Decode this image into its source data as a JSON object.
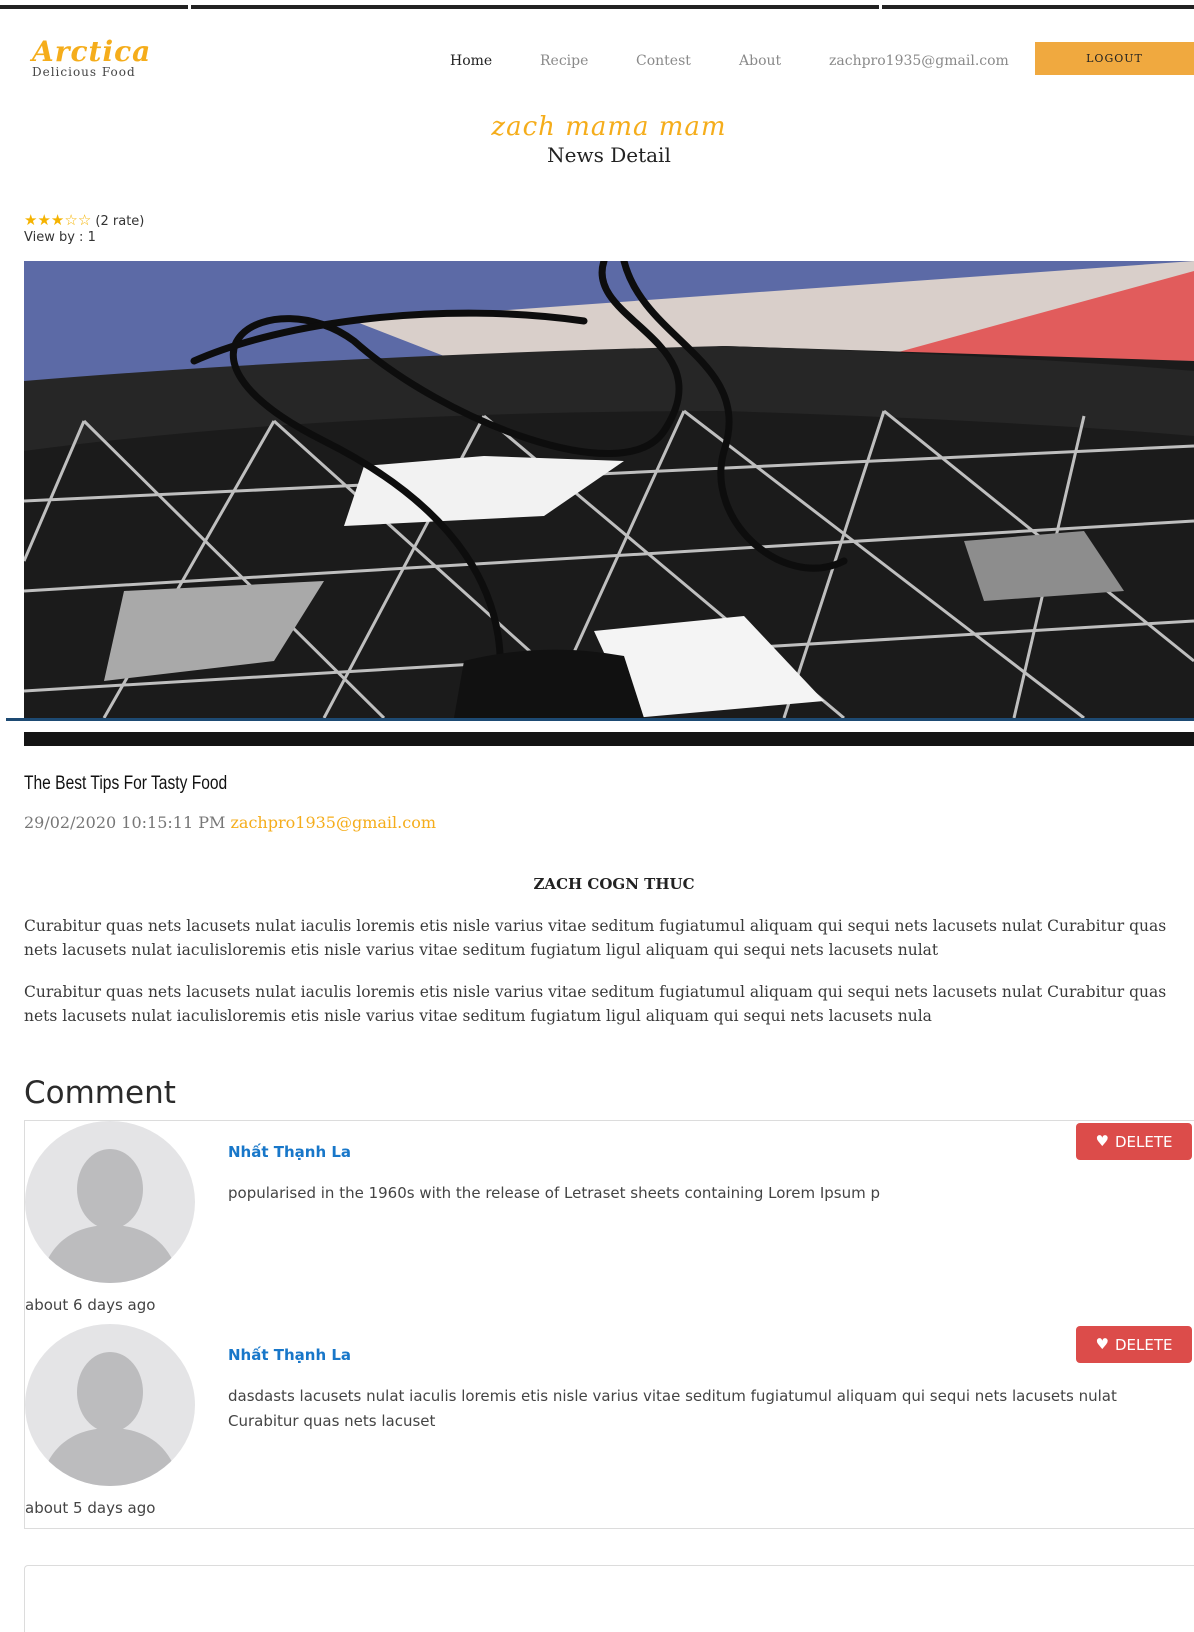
{
  "brand": {
    "name": "Arctica",
    "tagline": "Delicious Food"
  },
  "nav": {
    "items": [
      {
        "label": "Home"
      },
      {
        "label": "Recipe"
      },
      {
        "label": "Contest"
      },
      {
        "label": "About"
      },
      {
        "label": "zachpro1935@gmail.com"
      }
    ],
    "active": "Home",
    "logout_label": "LOGOUT"
  },
  "hero": {
    "script_title": "zach mama mam",
    "subtitle": "News Detail"
  },
  "rating": {
    "stars_filled": 3,
    "stars_total": 5,
    "label": "(2 rate)",
    "views": "View by : 1"
  },
  "post": {
    "title": "The Best Tips For Tasty Food",
    "date": "29/02/2020 10:15:11 PM",
    "author": "zachpro1935@gmail.com",
    "section_heading": "ZACH COGN THUC",
    "paragraphs": [
      "Curabitur quas nets lacusets nulat iaculis loremis etis nisle varius vitae seditum fugiatumul aliquam qui sequi nets lacusets nulat Curabitur quas nets lacusets nulat iaculisloremis etis nisle varius vitae seditum fugiatum ligul aliquam qui sequi nets lacusets nulat",
      "Curabitur quas nets lacusets nulat iaculis loremis etis nisle varius vitae seditum fugiatumul aliquam qui sequi nets lacusets nulat Curabitur quas nets lacusets nulat iaculisloremis etis nisle varius vitae seditum fugiatum ligul aliquam qui sequi nets lacusets nula"
    ]
  },
  "comments": {
    "heading": "Comment",
    "delete_label": "DELETE",
    "items": [
      {
        "name": "Nhất Thạnh La",
        "text": "popularised in the 1960s with the release of Letraset sheets containing Lorem Ipsum p",
        "time": "about 6 days ago"
      },
      {
        "name": "Nhất Thạnh La",
        "text": "dasdasts lacusets nulat iaculis loremis etis nisle varius vitae seditum fugiatumul aliquam qui sequi nets lacusets nulat Curabitur quas nets lacuset",
        "time": "about 5 days ago"
      }
    ]
  },
  "colors": {
    "accent": "#f5ad1b",
    "logout_bg": "#f0a93f",
    "delete_bg": "#dc4c4a",
    "link_blue": "#1877c9"
  },
  "icons": {
    "star": "star-icon",
    "heart": "heart-icon",
    "avatar": "user-silhouette-icon"
  }
}
